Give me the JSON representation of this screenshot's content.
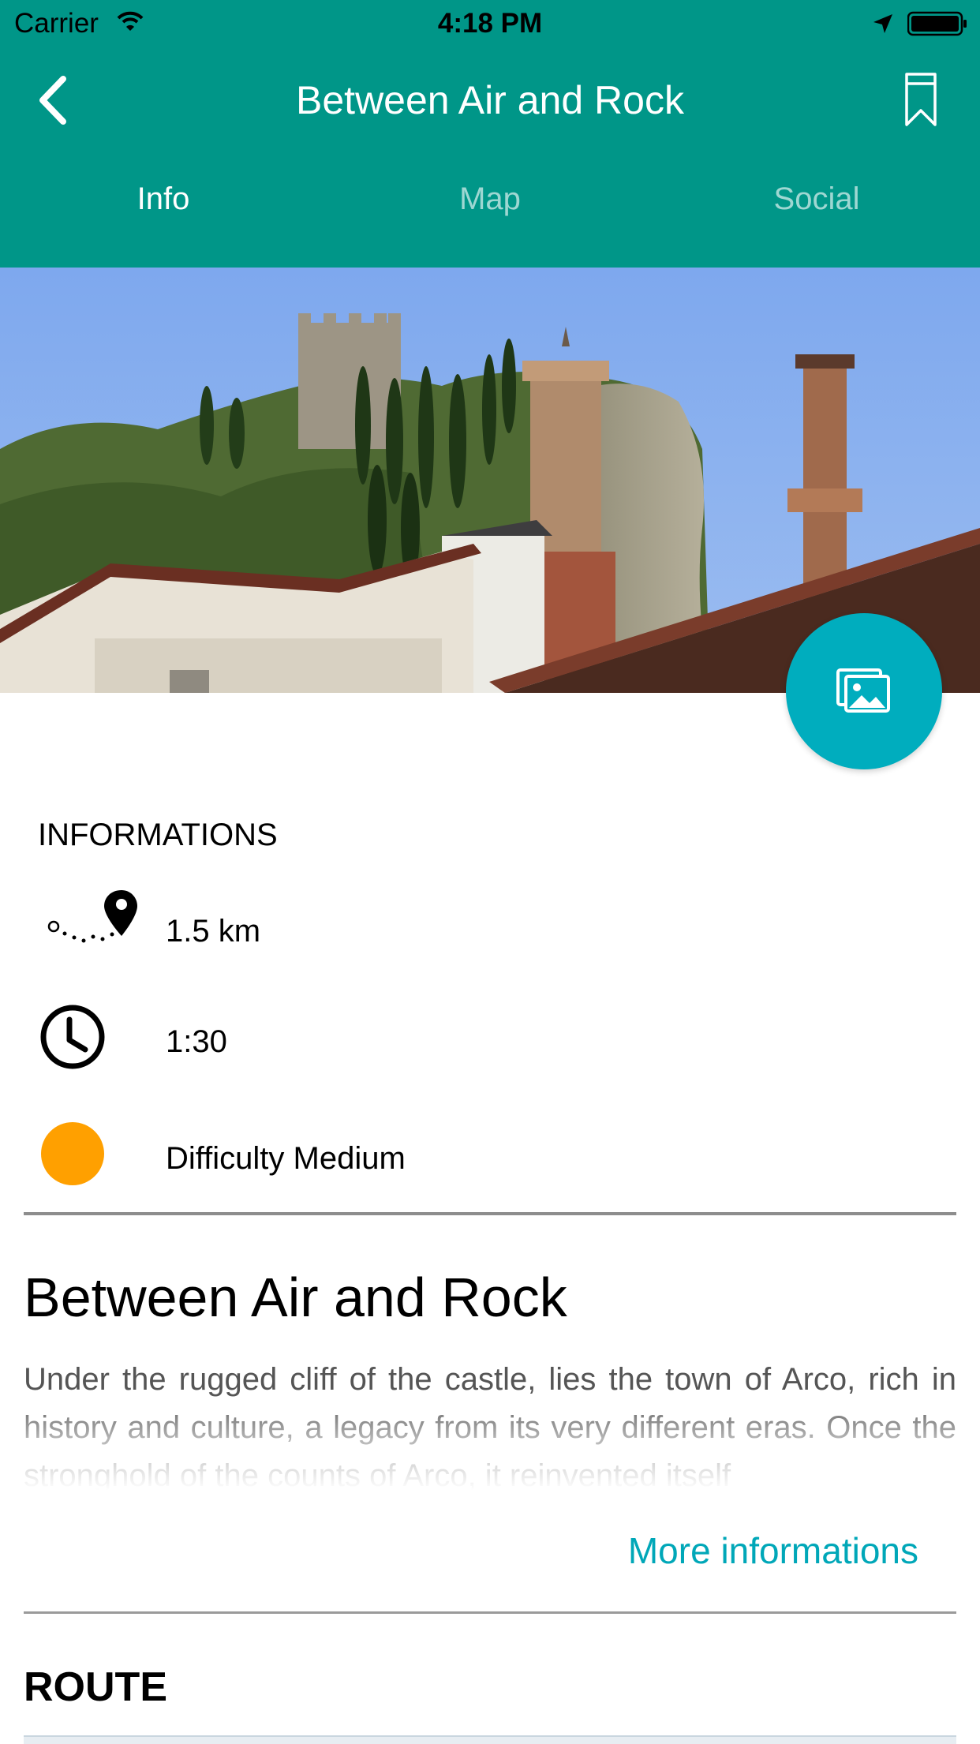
{
  "status_bar": {
    "carrier": "Carrier",
    "time": "4:18 PM"
  },
  "nav": {
    "title": "Between Air and Rock",
    "back_icon": "chevron-left-icon",
    "bookmark_icon": "bookmark-icon"
  },
  "tabs": [
    {
      "label": "Info",
      "active": true
    },
    {
      "label": "Map",
      "active": false
    },
    {
      "label": "Social",
      "active": false
    }
  ],
  "hero": {
    "image": "photo of Arco castle on a cliff with towers and rooftops"
  },
  "gallery_button": {
    "icon": "image-gallery-icon"
  },
  "info": {
    "heading": "INFORMATIONS",
    "distance": {
      "icon": "route-distance-icon",
      "value": "1.5 km"
    },
    "duration": {
      "icon": "clock-icon",
      "value": "1:30"
    },
    "difficulty": {
      "icon": "difficulty-dot-icon",
      "value": "Difficulty Medium",
      "color": "#ffa000"
    }
  },
  "article": {
    "title": "Between Air and Rock",
    "description": "Under the rugged cliff of the castle, lies the town of Arco, rich in history and culture, a legacy from its very different eras. Once the stronghold of the counts of Arco, it reinvented itself",
    "more_link": "More informations"
  },
  "route": {
    "heading": "ROUTE"
  },
  "colors": {
    "header": "#009688",
    "accent": "#00adbe",
    "link": "#00a7b8",
    "difficulty": "#ffa000"
  }
}
